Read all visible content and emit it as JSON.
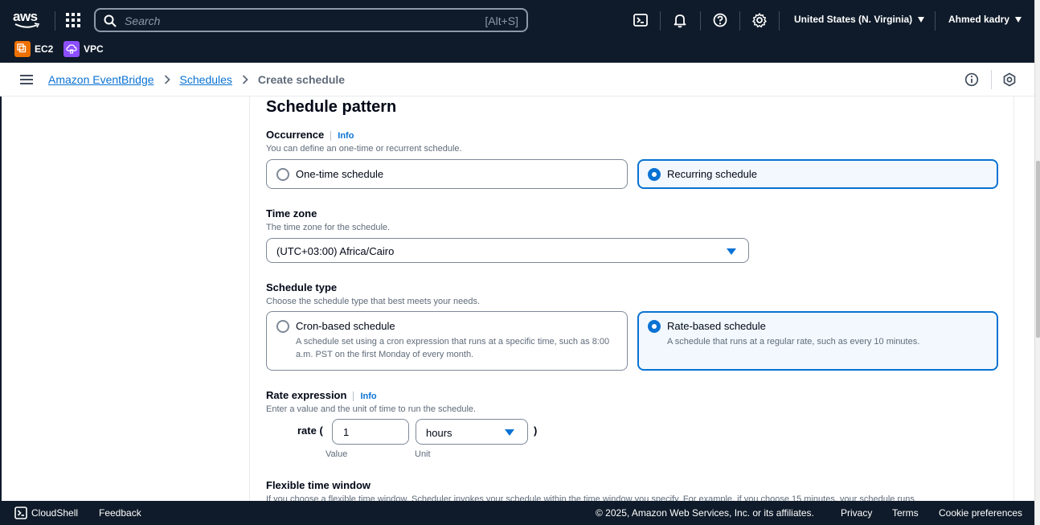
{
  "topbar": {
    "logo_text": "aws",
    "search_placeholder": "Search",
    "search_shortcut": "[Alt+S]",
    "region": "United States (N. Virginia)",
    "user": "Ahmed kadry",
    "icons": [
      "cloudshell-icon",
      "bell-icon",
      "help-icon",
      "gear-icon"
    ]
  },
  "favorites": [
    {
      "label": "EC2",
      "color": "#ed7100"
    },
    {
      "label": "VPC",
      "color": "#8c4fff"
    }
  ],
  "breadcrumb": {
    "items": [
      "Amazon EventBridge",
      "Schedules"
    ],
    "current": "Create schedule"
  },
  "main": {
    "title": "Schedule pattern",
    "occurrence": {
      "label": "Occurrence",
      "info": "Info",
      "description": "You can define an one-time or recurrent schedule.",
      "options": [
        {
          "label": "One-time schedule",
          "selected": false
        },
        {
          "label": "Recurring schedule",
          "selected": true
        }
      ]
    },
    "timezone": {
      "label": "Time zone",
      "description": "The time zone for the schedule.",
      "value": "(UTC+03:00) Africa/Cairo"
    },
    "schedule_type": {
      "label": "Schedule type",
      "description": "Choose the schedule type that best meets your needs.",
      "options": [
        {
          "label": "Cron-based schedule",
          "description": "A schedule set using a cron expression that runs at a specific time, such as 8:00 a.m. PST on the first Monday of every month.",
          "selected": false
        },
        {
          "label": "Rate-based schedule",
          "description": "A schedule that runs at a regular rate, such as every 10 minutes.",
          "selected": true
        }
      ]
    },
    "rate_expression": {
      "label": "Rate expression",
      "info": "Info",
      "description": "Enter a value and the unit of time to run the schedule.",
      "prefix": "rate (",
      "suffix": ")",
      "value": "1",
      "value_caption": "Value",
      "unit": "hours",
      "unit_caption": "Unit"
    },
    "flexible_window": {
      "label": "Flexible time window",
      "description": "If you choose a flexible time window, Scheduler invokes your schedule within the time window you specify. For example, if you choose 15 minutes, your schedule runs"
    }
  },
  "footer": {
    "cloudshell": "CloudShell",
    "feedback": "Feedback",
    "copyright": "© 2025, Amazon Web Services, Inc. or its affiliates.",
    "privacy": "Privacy",
    "terms": "Terms",
    "cookie": "Cookie preferences"
  },
  "colors": {
    "nav_bg": "#0f1b2a",
    "accent": "#0972d3",
    "selected_bg": "#f2f8fd"
  }
}
